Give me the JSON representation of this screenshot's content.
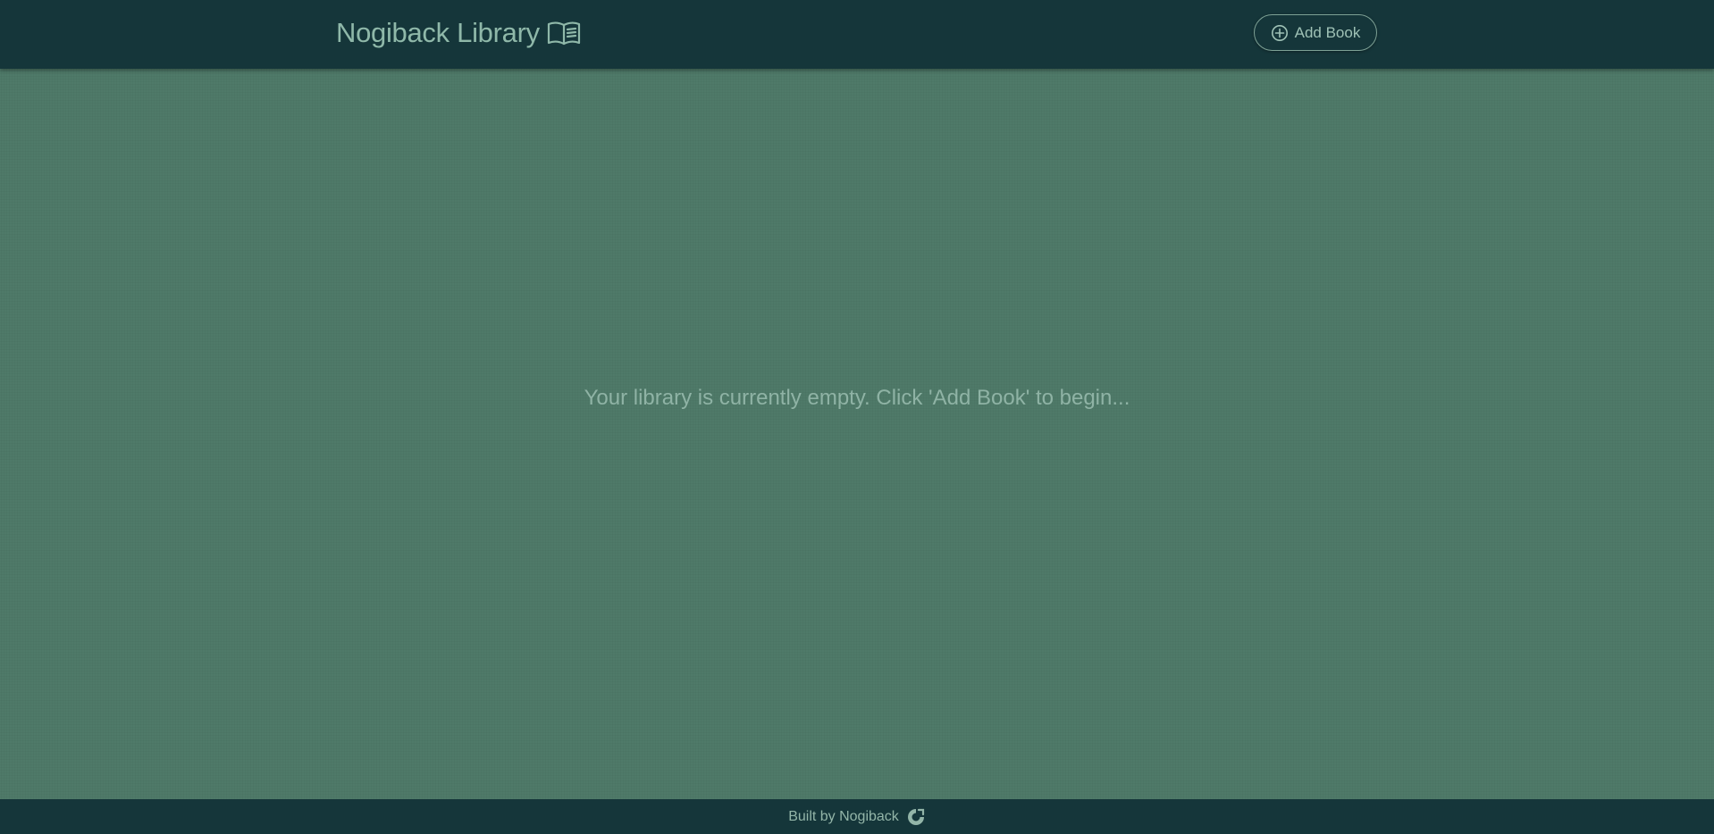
{
  "header": {
    "title": "Nogiback Library",
    "title_icon": "open-book-icon",
    "add_button_label": "Add Book",
    "add_button_icon": "plus-circle-icon"
  },
  "main": {
    "empty_message": "Your library is currently empty. Click 'Add Book' to begin..."
  },
  "footer": {
    "text": "Built by Nogiback",
    "icon": "github-logo-icon"
  },
  "colors": {
    "background": "#4f7a69",
    "header_footer": "#15363a",
    "text": "#8fb8a9"
  }
}
